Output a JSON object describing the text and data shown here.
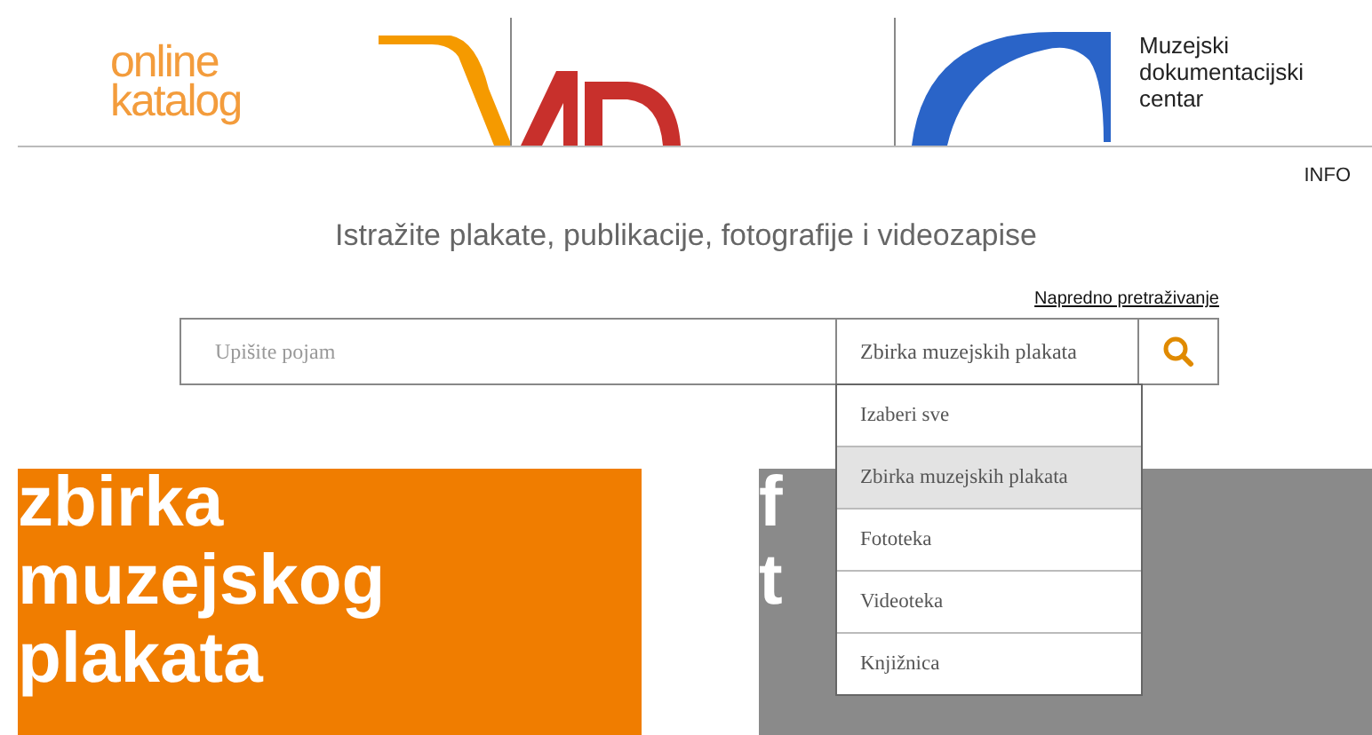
{
  "logo": {
    "lines": [
      "online",
      "katalog"
    ]
  },
  "institution": {
    "lines": [
      "Muzejski",
      "dokumentacijski",
      "centar"
    ]
  },
  "nav": {
    "info": "INFO"
  },
  "heading": "Istražite plakate, publikacije, fotografije i videozapise",
  "advanced_search": "Napredno pretraživanje",
  "search": {
    "placeholder": "Upišite pojam",
    "collection_select": {
      "value": "Zbirka muzejskih plakata",
      "expanded": true,
      "options": [
        {
          "label": "Izaberi sve",
          "selected": false
        },
        {
          "label": "Zbirka muzejskih plakata",
          "selected": true
        },
        {
          "label": "Fototeka",
          "selected": false
        },
        {
          "label": "Videoteka",
          "selected": false
        },
        {
          "label": "Knjižnica",
          "selected": false
        }
      ]
    }
  },
  "cards": [
    {
      "lines": [
        "zbirka",
        "muzejskog",
        "plakata"
      ],
      "color": "#f07d00"
    },
    {
      "lines": [
        "f",
        "t"
      ],
      "color": "#8a8a8a"
    }
  ]
}
